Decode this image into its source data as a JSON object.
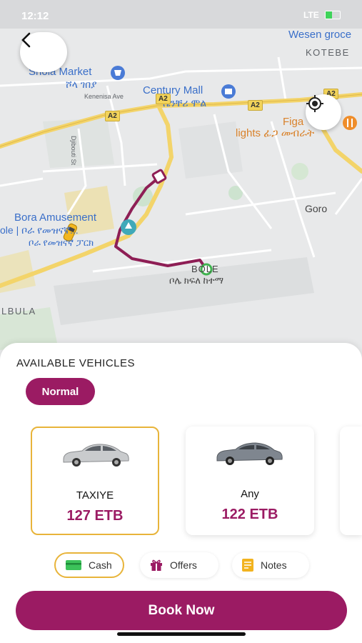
{
  "status_bar": {
    "time": "12:12",
    "network": "LTE"
  },
  "map": {
    "pois": [
      {
        "name": "Shola Market",
        "amharic": "ሾላ ገበያ"
      },
      {
        "name": "Century Mall",
        "amharic": "ሴንቸሪ ሞል"
      },
      {
        "name": "Figa lights",
        "amharic": "ፊጋ መብራት"
      },
      {
        "name": "Bora Amusement Park",
        "amharic": "ቦሌ | ቦራ የመዝናኛ... ቦራ የመዝናኛ ፓርክ"
      },
      {
        "name": "BOLE",
        "amharic": "ቦሌ ክፍለ ከተማ"
      },
      {
        "name": "Wesen grocery"
      }
    ],
    "areas": [
      "KOTEBE",
      "Goro",
      "BULBULA"
    ],
    "streets": [
      "Kenenisa Ave",
      "Djibouti St"
    ],
    "roads": [
      "A2",
      "A2",
      "A2",
      "A2"
    ],
    "labels": {
      "shola": "Shola Market",
      "shola_am": "ሾላ ገበያ",
      "century": "Century Mall",
      "century_am": "ሴንቸሪ ሞል",
      "figa": "Figa",
      "figa_lights": "lights ፊጋ መብራት",
      "bora1": "Bora Amusement",
      "bora2": "ole | ቦራ የመዝናኛ...",
      "bora3": "ቦራ የመዝናኛ ፓርክ",
      "bole": "BOLE",
      "bole_am": "ቦሌ ክፍለ ከተማ",
      "wesen": "Wesen groce",
      "kotebe": "KOTEBE",
      "goro": "Goro",
      "bulbula": "LBULA",
      "kenenisa": "Kenenisa Ave",
      "djibouti": "Djibouti St",
      "a2": "A2"
    }
  },
  "sheet": {
    "section_title": "AVAILABLE VEHICLES",
    "category_chip": "Normal",
    "vehicles": [
      {
        "name": "TAXIYE",
        "price": "127 ETB",
        "selected": true
      },
      {
        "name": "Any",
        "price": "122 ETB",
        "selected": false
      }
    ],
    "options": {
      "cash": "Cash",
      "offers": "Offers",
      "notes": "Notes"
    },
    "book_button": "Book Now"
  },
  "colors": {
    "brand": "#9b1b63",
    "selected_border": "#e8b43a",
    "route": "#8e1e55",
    "map_blue": "#3a6fc9"
  }
}
